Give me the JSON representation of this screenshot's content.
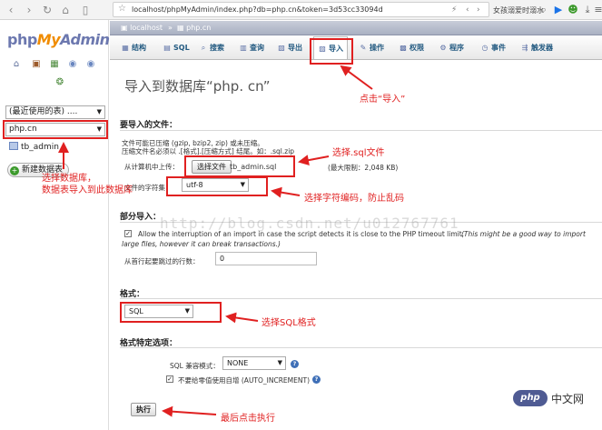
{
  "browser": {
    "url": "localhost/phpMyAdmin/index.php?db=php.cn&token=3d53cc33094d",
    "search_text": "女孩溺爱时溺水",
    "icons": [
      "back-icon",
      "forward-icon",
      "reload-icon",
      "home-icon",
      "reader-icon",
      "star-icon"
    ]
  },
  "left": {
    "logo_php": "php",
    "logo_my": "My",
    "logo_admin": "Admin",
    "recent_select": "(最近使用的表) ....",
    "db_select": "php.cn",
    "table_item": "tb_admin",
    "new_table": "新建数据表"
  },
  "crumb": {
    "server": "localhost",
    "db": "php.cn"
  },
  "tabs": [
    {
      "icon": "▦",
      "label": "结构"
    },
    {
      "icon": "▤",
      "label": "SQL"
    },
    {
      "icon": "⌕",
      "label": "搜索"
    },
    {
      "icon": "▥",
      "label": "查询"
    },
    {
      "icon": "▧",
      "label": "导出"
    },
    {
      "icon": "▨",
      "label": "导入"
    },
    {
      "icon": "✎",
      "label": "操作"
    },
    {
      "icon": "▩",
      "label": "权限"
    },
    {
      "icon": "⚙",
      "label": "程序"
    },
    {
      "icon": "◷",
      "label": "事件"
    },
    {
      "icon": "⇶",
      "label": "触发器"
    }
  ],
  "main": {
    "page_title": "导入到数据库“php. cn”",
    "file_section": "要导入的文件：",
    "file_hint_1": "文件可能已压缩 (gzip, bzip2, zip) 或未压缩。",
    "file_hint_2": "压缩文件名必须以 .[格式].[压缩方式] 结尾。如：.sql.zip",
    "upload_label": "从计算机中上传：",
    "choose_file": "选择文件",
    "file_name": "tb_admin.sql",
    "max_limit": "(最大限制：2,048 KB)",
    "charset_label": "文件的字符集：",
    "charset_value": "utf-8",
    "partial_section": "部分导入：",
    "partial_text_1": "Allow the interruption of an import in case the script detects it is close to the PHP timeout limit.",
    "partial_text_1b": "(This might be a good way to import",
    "partial_text_2": "large files, however it can break transactions.)",
    "skip_label": "从首行起要跳过的行数：",
    "skip_value": "0",
    "format_section": "格式：",
    "format_value": "SQL",
    "format_options_section": "格式特定选项：",
    "compat_label": "SQL 兼容模式：",
    "compat_value": "NONE",
    "auto_inc_label": "不要给零值使用自增 (AUTO_INCREMENT)",
    "execute": "执行"
  },
  "annotations": {
    "click_import": "点击“导入”",
    "select_file": "选择.sql文件",
    "select_db_1": "选择数据库，",
    "select_db_2": "数据表导入到此数据库",
    "select_charset": "选择字符编码，防止乱码",
    "select_sql": "选择SQL格式",
    "click_execute": "最后点击执行"
  },
  "watermark": "http://blog.csdn.net/u012767761",
  "badge": {
    "php": "php",
    "cn": "中文网"
  },
  "colors": {
    "annotation": "#e02020",
    "logo_blue": "#6c78af",
    "logo_orange": "#f08c00",
    "link_blue": "#235a81"
  }
}
